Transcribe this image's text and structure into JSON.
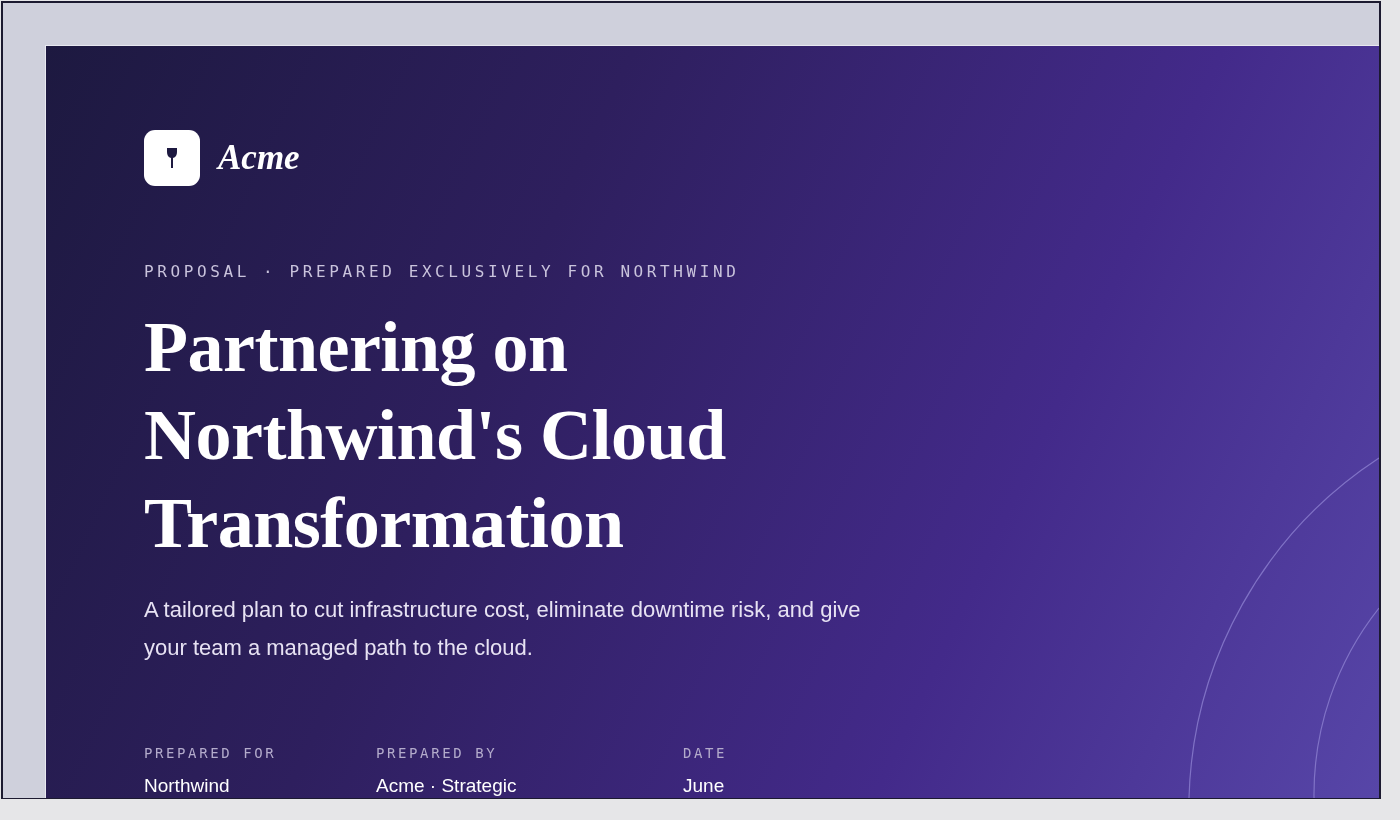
{
  "brand": {
    "name": "Acme"
  },
  "eyebrow": "PROPOSAL · PREPARED EXCLUSIVELY FOR NORTHWIND",
  "title": "Partnering on Northwind's Cloud Transformation",
  "subtitle": "A tailored plan to cut infrastructure cost, eliminate downtime risk, and give your team a managed path to the cloud.",
  "meta": [
    {
      "label": "PREPARED FOR",
      "value": "Northwind"
    },
    {
      "label": "PREPARED BY",
      "value": "Acme · Strategic"
    },
    {
      "label": "DATE",
      "value": "June"
    }
  ]
}
